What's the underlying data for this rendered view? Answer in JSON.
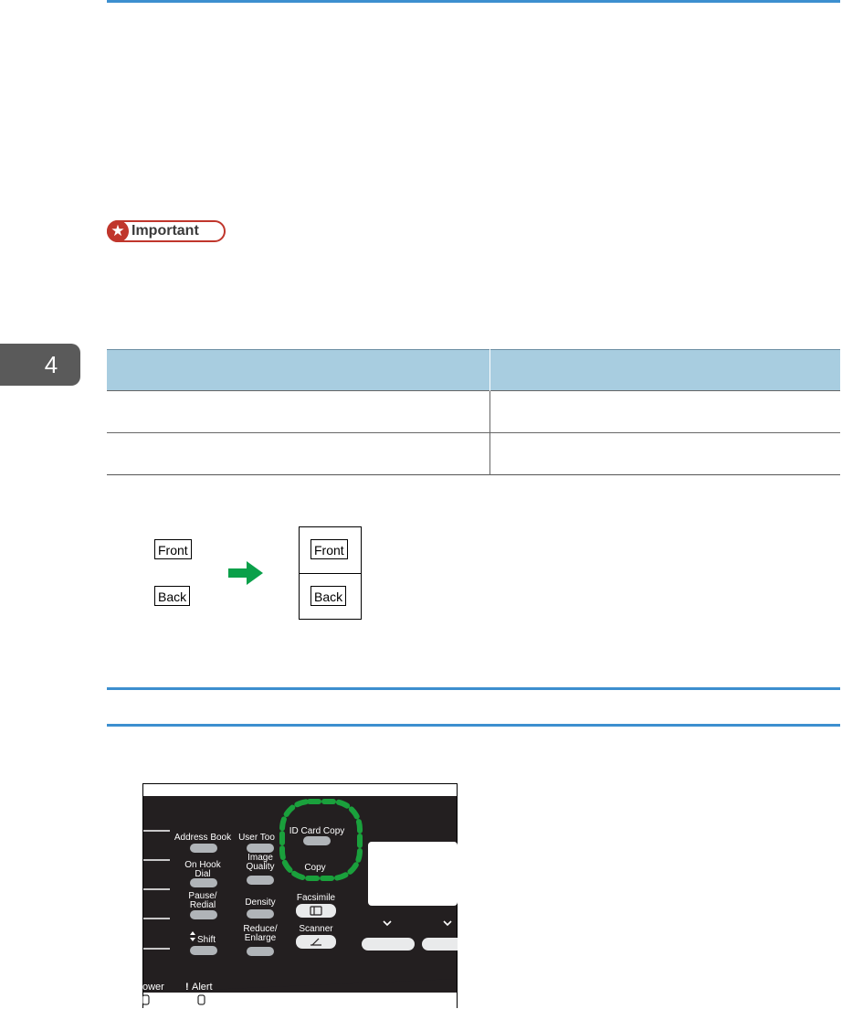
{
  "chapter": {
    "number": "4"
  },
  "important": {
    "label": "Important"
  },
  "paper_table": {
    "headers": [
      "",
      ""
    ],
    "rows": [
      [
        "",
        ""
      ],
      [
        "",
        ""
      ]
    ]
  },
  "illustration": {
    "front_label": "Front",
    "back_label": "Back",
    "arrow_color": "#0aa04a"
  },
  "control_panel": {
    "buttons": {
      "address_book": "Address Book",
      "user_tools": "User Too",
      "id_card_copy": "ID Card Copy",
      "on_hook_dial_1": "On Hook",
      "on_hook_dial_2": "Dial",
      "image_quality_1": "Image",
      "image_quality_2": "Quality",
      "copy": "Copy",
      "pause_redial_1": "Pause/",
      "pause_redial_2": "Redial",
      "density": "Density",
      "facsimile": "Facsimile",
      "shift": "Shift",
      "reduce_enlarge_1": "Reduce/",
      "reduce_enlarge_2": "Enlarge",
      "scanner": "Scanner"
    },
    "indicators": {
      "power": "ower",
      "alert": "Alert"
    },
    "highlight_color": "#1aa03c",
    "panel_color": "#231f20"
  }
}
